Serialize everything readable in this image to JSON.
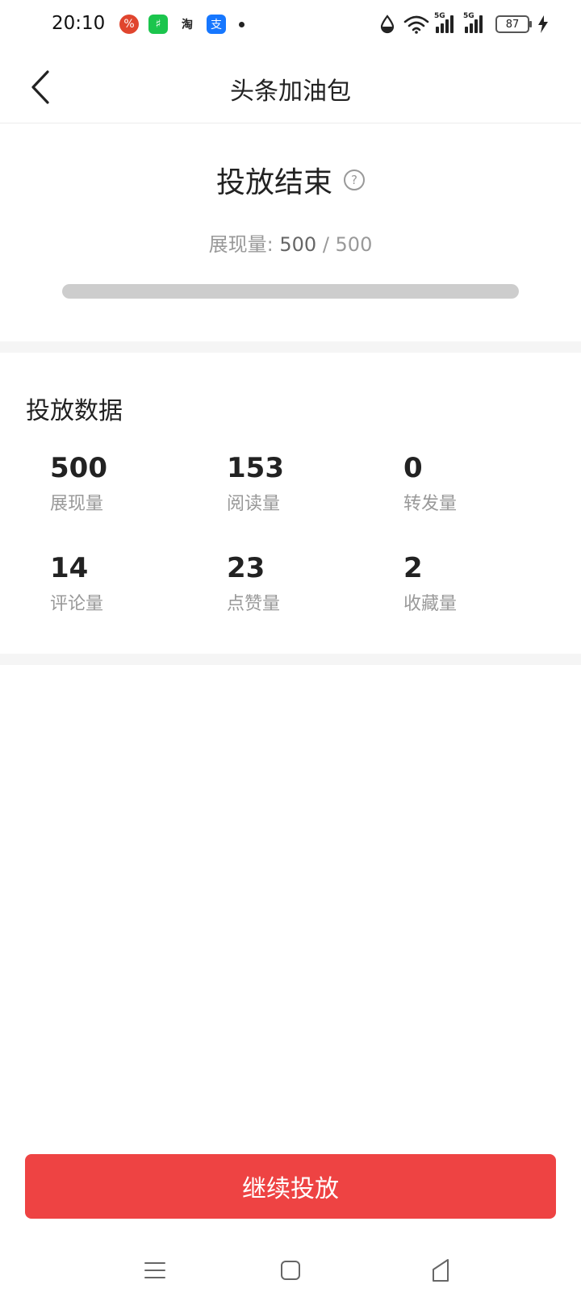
{
  "status_bar": {
    "time": "20:10",
    "apps": [
      {
        "icon": "pinduoduo-icon",
        "glyph": "%",
        "color": "#e0452e"
      },
      {
        "icon": "wechat-pay-icon",
        "glyph": "♯",
        "color": "#1bc54d"
      },
      {
        "icon": "taobao-icon",
        "glyph": "淘",
        "color": "#ffffff"
      },
      {
        "icon": "alipay-icon",
        "glyph": "支",
        "color": "#1677ff"
      }
    ],
    "network_tag_1": "5G",
    "network_tag_2": "5G",
    "battery": "87"
  },
  "header": {
    "title": "头条加油包",
    "back_icon": "chevron-left-icon"
  },
  "summary": {
    "status_title": "投放结束",
    "help_glyph": "?",
    "impressions_label": "展现量: ",
    "impressions_current": "500",
    "impressions_separator": " / ",
    "impressions_total": "500",
    "progress_fraction": 1.0
  },
  "stats": {
    "title": "投放数据",
    "items": [
      {
        "value": "500",
        "label": "展现量"
      },
      {
        "value": "153",
        "label": "阅读量"
      },
      {
        "value": "0",
        "label": "转发量"
      },
      {
        "value": "14",
        "label": "评论量"
      },
      {
        "value": "23",
        "label": "点赞量"
      },
      {
        "value": "2",
        "label": "收藏量"
      }
    ]
  },
  "cta": {
    "label": "继续投放"
  },
  "colors": {
    "accent": "#ee4343",
    "progress_fill": "#cdcdcd",
    "secondary_text": "#999999"
  }
}
